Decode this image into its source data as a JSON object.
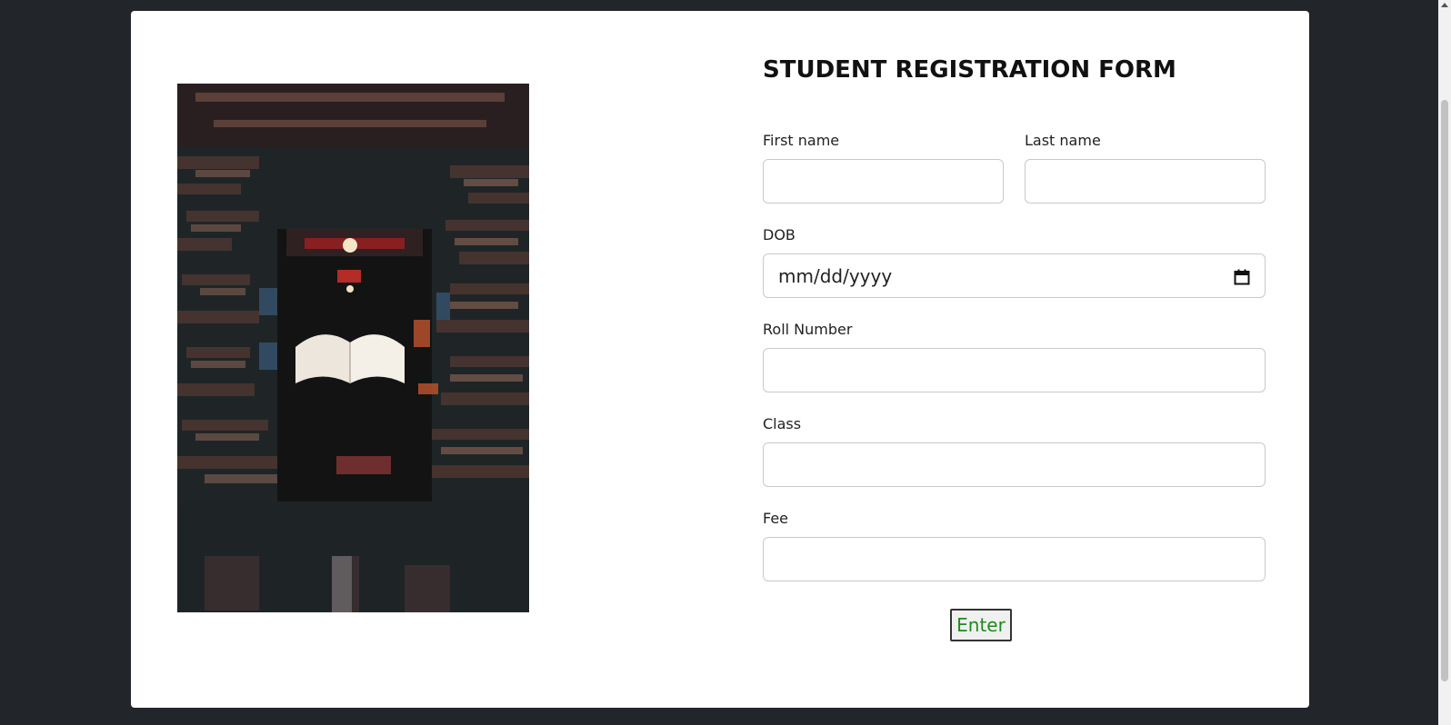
{
  "form": {
    "title": "STUDENT REGISTRATION FORM",
    "first_name_label": "First name",
    "first_name_value": "",
    "last_name_label": "Last name",
    "last_name_value": "",
    "dob_label": "DOB",
    "dob_placeholder": "mm/dd/yyyy",
    "roll_label": "Roll Number",
    "roll_value": "",
    "class_label": "Class",
    "class_value": "",
    "fee_label": "Fee",
    "fee_value": "",
    "submit_label": "Enter"
  },
  "image": {
    "subject": "library-books-floating-book-photo"
  },
  "icons": {
    "calendar": "calendar-icon"
  },
  "colors": {
    "background": "#22262b",
    "submit_text": "#1e8b1e"
  }
}
